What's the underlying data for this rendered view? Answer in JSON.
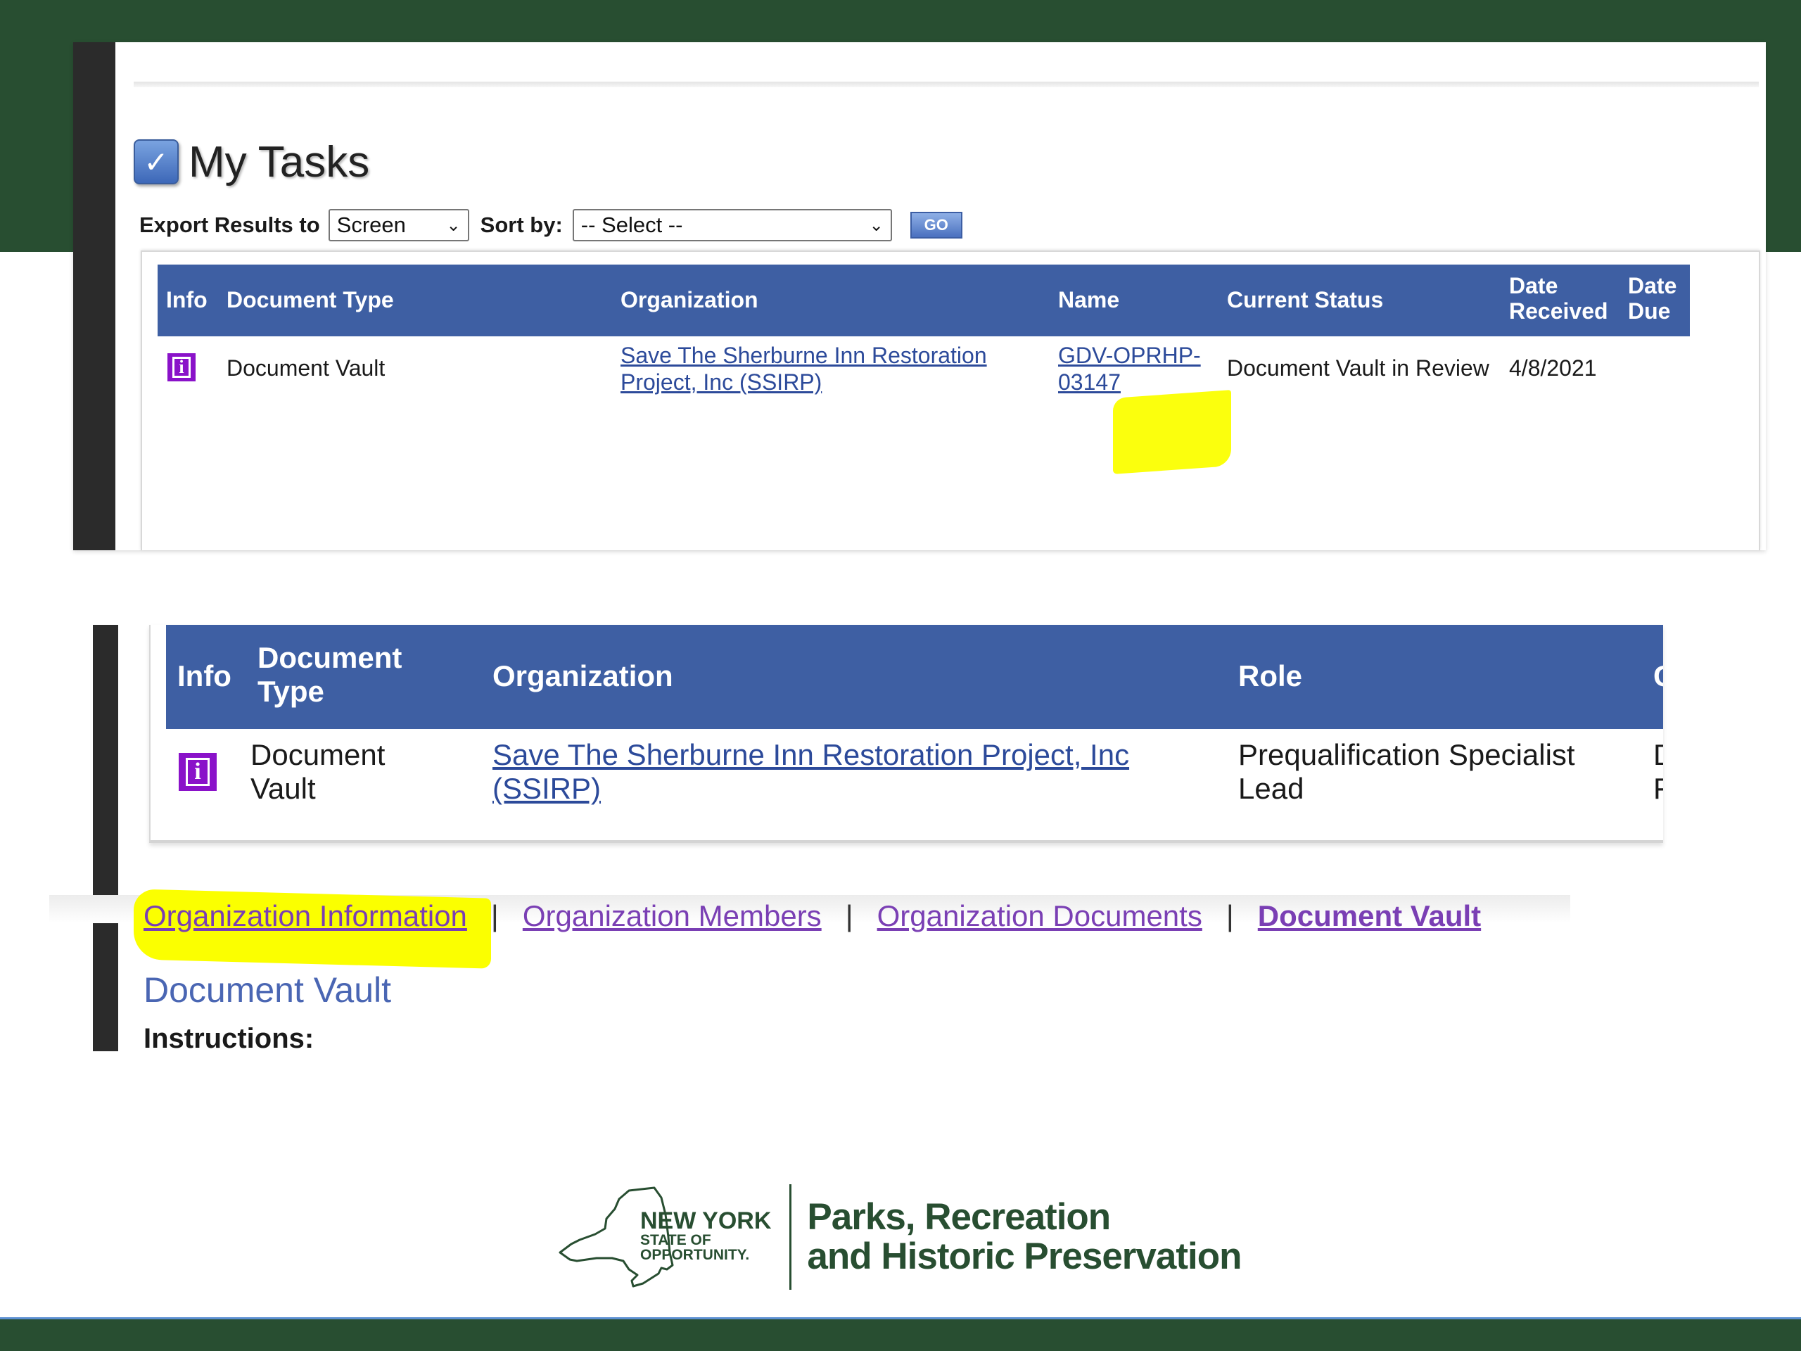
{
  "colors": {
    "frame_green": "#284e31",
    "table_header": "#3e5fa3",
    "info_icon": "#8a12c9",
    "link_blue": "#2c4a9a",
    "link_visited": "#7a3fb4",
    "highlight": "#fbff00"
  },
  "icons": {
    "tasks": "checkbox-check-icon",
    "info": "info-icon",
    "dropdown": "chevron-down-icon",
    "logo_map": "new-york-state-outline-icon"
  },
  "my_tasks": {
    "title": "My Tasks",
    "export_label": "Export Results to",
    "export_value": "Screen",
    "sort_label": "Sort by:",
    "sort_value": "-- Select --",
    "go_label": "GO",
    "columns": {
      "info": "Info",
      "document_type": "Document Type",
      "organization": "Organization",
      "name": "Name",
      "current_status": "Current Status",
      "date_received_1": "Date",
      "date_received_2": "Received",
      "date_due_1": "Date",
      "date_due_2": "Due"
    },
    "rows": [
      {
        "info_glyph": "i",
        "document_type": "Document Vault",
        "organization_line1": "Save The Sherburne Inn Restoration",
        "organization_line2": "Project, Inc (SSIRP)",
        "name_line1": "GDV-OPRHP-",
        "name_line2": "03147",
        "current_status": "Document Vault in Review",
        "date_received": "4/8/2021",
        "date_due": ""
      }
    ]
  },
  "org_view": {
    "columns": {
      "info": "Info",
      "document_type_1": "Document",
      "document_type_2": "Type",
      "organization": "Organization",
      "role": "Role",
      "cut_off": "C"
    },
    "rows": [
      {
        "info_glyph": "i",
        "document_type_1": "Document",
        "document_type_2": "Vault",
        "organization_line1": "Save The Sherburne Inn Restoration Project, Inc",
        "organization_line2": "(SSIRP)",
        "role_line1": "Prequalification Specialist",
        "role_line2": "Lead",
        "cut_off_1": "D",
        "cut_off_2": "F"
      }
    ],
    "nav": {
      "org_info": "Organization Information",
      "sep": "|",
      "org_members": "Organization Members",
      "org_documents": "Organization Documents",
      "doc_vault": "Document Vault"
    },
    "section_title": "Document Vault",
    "instructions_label": "Instructions:"
  },
  "logo": {
    "ny_line1": "NEW YORK",
    "ny_line2": "STATE OF",
    "ny_line3": "OPPORTUNITY.",
    "agency_line1": "Parks, Recreation",
    "agency_line2": "and Historic Preservation"
  }
}
